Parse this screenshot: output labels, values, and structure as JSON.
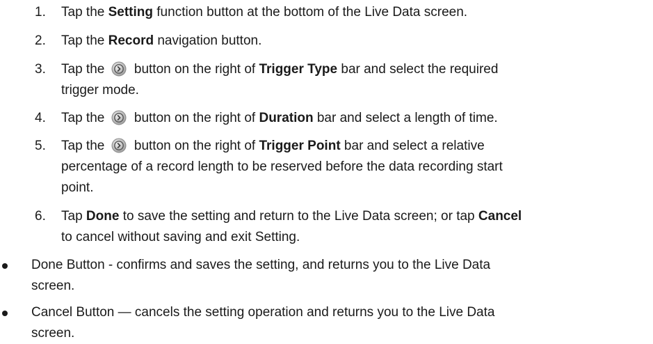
{
  "steps": [
    {
      "num": "1.",
      "pre": "Tap the ",
      "bold": "Setting",
      "post": " function button at the bottom of the Live Data screen."
    },
    {
      "num": "2.",
      "pre": "Tap the ",
      "bold": "Record",
      "post": " navigation button."
    },
    {
      "num": "3.",
      "pre": "Tap the ",
      "mid": " button on the right of ",
      "bold": "Trigger Type",
      "post": " bar and select the required",
      "cont": "trigger mode."
    },
    {
      "num": "4.",
      "pre": "Tap the ",
      "mid": " button on the right of ",
      "bold": "Duration",
      "post": " bar and select a length of time."
    },
    {
      "num": "5.",
      "pre": "Tap the ",
      "mid": " button on the right of ",
      "bold": "Trigger Point",
      "post": " bar and select a relative",
      "cont1": "percentage of a record length to be reserved before the data recording start",
      "cont2": "point."
    },
    {
      "num": "6.",
      "pre": "Tap ",
      "bold": "Done",
      "mid": " to save the setting and return to the Live Data screen; or tap ",
      "bold2": "Cancel",
      "cont": "to cancel without saving and exit Setting."
    }
  ],
  "bullets": [
    {
      "line1": "Done Button - confirms and saves the setting, and returns you to the Live Data",
      "line2": "screen."
    },
    {
      "line1": "Cancel Button — cancels the setting operation and returns you to the Live Data",
      "line2": "screen."
    }
  ],
  "icons": {
    "arrow_button": "circle-arrow-right-icon"
  }
}
